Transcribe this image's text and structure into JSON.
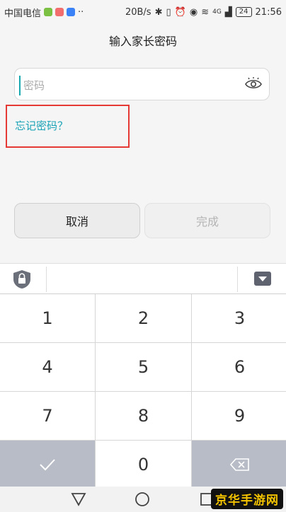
{
  "status_bar": {
    "carrier": "中国电信",
    "speed": "20B/s",
    "network": "4G",
    "battery": "24",
    "time": "21:56"
  },
  "title": "输入家长密码",
  "password": {
    "placeholder": "密码",
    "value": ""
  },
  "forgot_link": "忘记密码？",
  "buttons": {
    "cancel": "取消",
    "done": "完成"
  },
  "keypad": {
    "keys": [
      "1",
      "2",
      "3",
      "4",
      "5",
      "6",
      "7",
      "8",
      "9",
      "0"
    ]
  },
  "watermark": "京华手游网",
  "colors": {
    "accent": "#1aa3b6",
    "highlight_box": "#e53935"
  }
}
